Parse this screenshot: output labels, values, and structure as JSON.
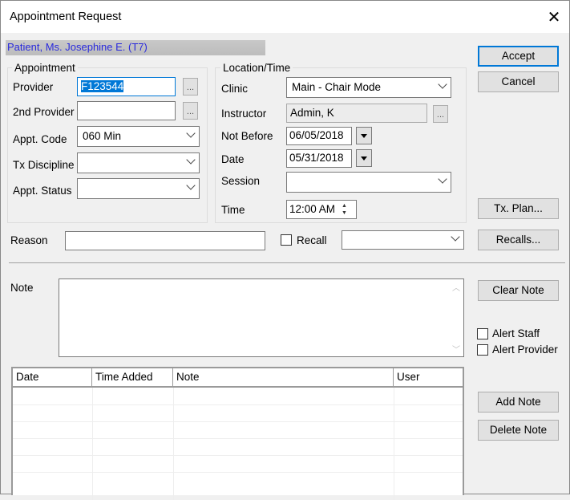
{
  "window": {
    "title": "Appointment Request",
    "close_icon": "close-icon"
  },
  "patient_banner": "Patient, Ms. Josephine E. (T7)",
  "appointment": {
    "group_label": "Appointment",
    "provider_label": "Provider",
    "provider_value": "F123544",
    "second_provider_label": "2nd Provider",
    "second_provider_value": "",
    "appt_code_label": "Appt. Code",
    "appt_code_value": "060 Min",
    "tx_discipline_label": "Tx Discipline",
    "tx_discipline_value": "",
    "appt_status_label": "Appt. Status",
    "appt_status_value": "",
    "browse_label": "..."
  },
  "location": {
    "group_label": "Location/Time",
    "clinic_label": "Clinic",
    "clinic_value": "Main - Chair Mode",
    "instructor_label": "Instructor",
    "instructor_value": "Admin, K",
    "not_before_label": "Not Before",
    "not_before_value": "06/05/2018",
    "date_label": "Date",
    "date_value": "05/31/2018",
    "session_label": "Session",
    "session_value": "",
    "time_label": "Time",
    "time_value": "12:00 AM"
  },
  "buttons": {
    "accept": "Accept",
    "cancel": "Cancel",
    "tx_plan": "Tx. Plan...",
    "recalls": "Recalls...",
    "clear_note": "Clear Note",
    "add_note": "Add Note",
    "delete_note": "Delete Note"
  },
  "reason": {
    "label": "Reason",
    "value": "",
    "recall_label": "Recall",
    "recall_checked": false,
    "recall_select_value": ""
  },
  "note": {
    "label": "Note",
    "value": ""
  },
  "alerts": {
    "alert_staff": "Alert Staff",
    "alert_provider": "Alert Provider"
  },
  "notes_grid": {
    "columns": [
      "Date",
      "Time Added",
      "Note",
      "User"
    ],
    "rows": []
  }
}
